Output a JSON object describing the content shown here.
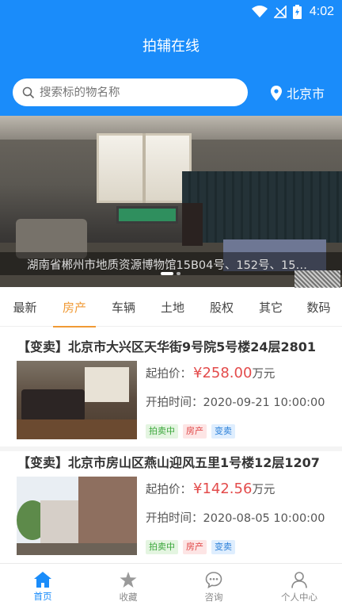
{
  "status_bar": {
    "time": "4:02"
  },
  "app": {
    "title": "拍辅在线"
  },
  "search": {
    "placeholder": "搜索标的物名称"
  },
  "location": {
    "city": "北京市",
    "icon": "location-pin-icon"
  },
  "banner": {
    "caption": "湖南省郴州市地质资源博物馆15B04号、152号、15…",
    "slide_count": 2,
    "active_slide": 1
  },
  "category_tabs": [
    {
      "label": "最新"
    },
    {
      "label": "房产",
      "active": true
    },
    {
      "label": "车辆"
    },
    {
      "label": "土地"
    },
    {
      "label": "股权"
    },
    {
      "label": "其它"
    },
    {
      "label": "数码"
    }
  ],
  "listings": [
    {
      "title": "【变卖】北京市大兴区天华街9号院5号楼24层2801",
      "price_label": "起拍价：",
      "price_currency": "¥",
      "price_value": "258.00",
      "price_unit": "万元",
      "time_label": "开拍时间：",
      "time_value": "2020-09-21 10:00:00",
      "tags": [
        "拍卖中",
        "房产",
        "变卖"
      ]
    },
    {
      "title": "【变卖】北京市房山区燕山迎风五里1号楼12层1207",
      "price_label": "起拍价：",
      "price_currency": "¥",
      "price_value": "142.56",
      "price_unit": "万元",
      "time_label": "开拍时间：",
      "time_value": "2020-08-05 10:00:00",
      "tags": [
        "拍卖中",
        "房产",
        "变卖"
      ]
    }
  ],
  "bottom_nav": [
    {
      "label": "首页",
      "icon": "home-icon",
      "active": true
    },
    {
      "label": "收藏",
      "icon": "star-icon"
    },
    {
      "label": "咨询",
      "icon": "chat-icon"
    },
    {
      "label": "个人中心",
      "icon": "user-icon"
    }
  ],
  "colors": {
    "primary": "#1a8cfa",
    "accent": "#f09a35",
    "price": "#e34b4b"
  }
}
